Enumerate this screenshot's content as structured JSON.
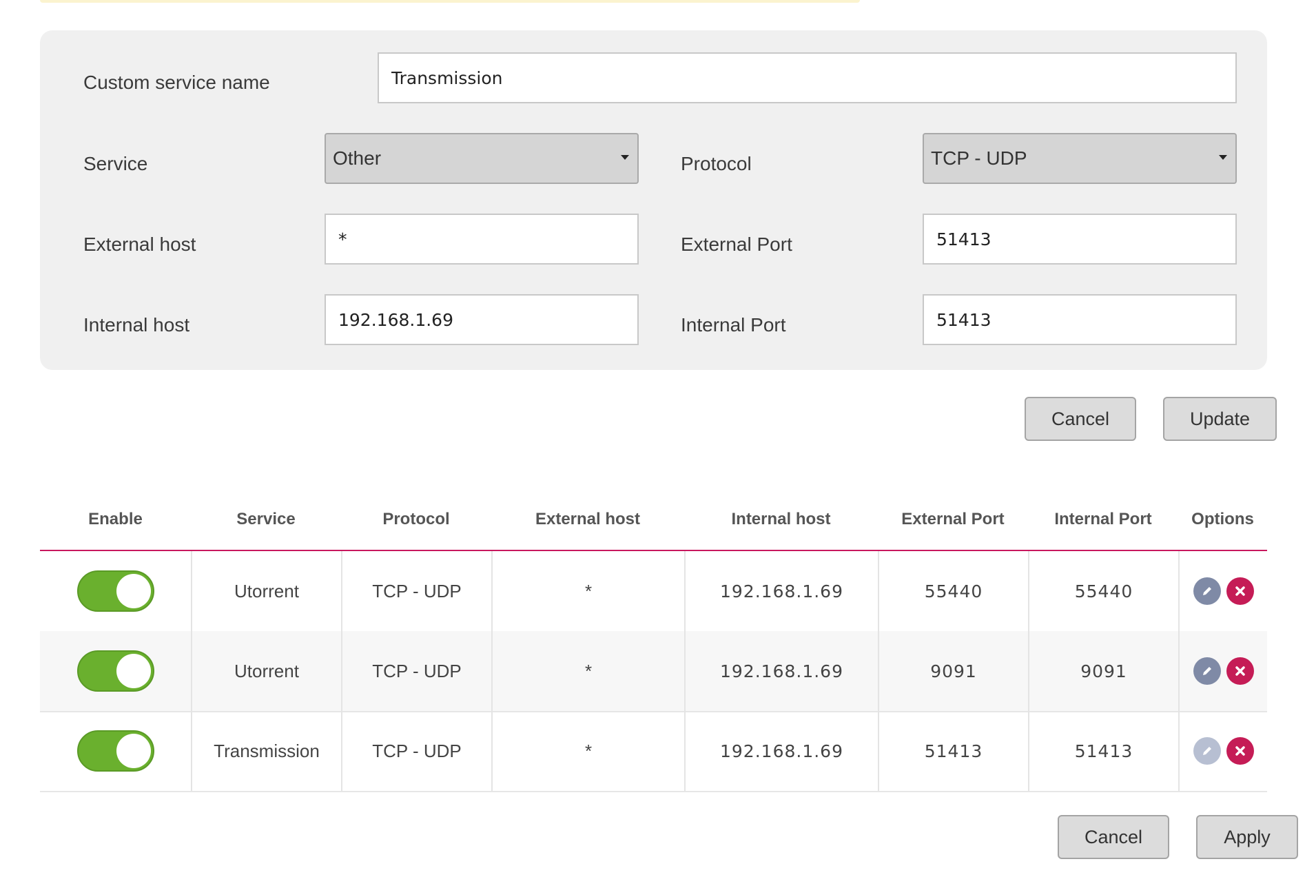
{
  "form": {
    "custom_name_label": "Custom service name",
    "custom_name_value": "Transmission",
    "service_label": "Service",
    "service_value": "Other",
    "protocol_label": "Protocol",
    "protocol_value": "TCP - UDP",
    "external_host_label": "External host",
    "external_host_value": "*",
    "external_port_label": "External Port",
    "external_port_value": "51413",
    "internal_host_label": "Internal host",
    "internal_host_value": "192.168.1.69",
    "internal_port_label": "Internal Port",
    "internal_port_value": "51413",
    "cancel_label": "Cancel",
    "update_label": "Update"
  },
  "table": {
    "headers": [
      "Enable",
      "Service",
      "Protocol",
      "External host",
      "Internal host",
      "External Port",
      "Internal Port",
      "Options"
    ],
    "rows": [
      {
        "enabled": true,
        "service": "Utorrent",
        "protocol": "TCP - UDP",
        "external_host": "*",
        "internal_host": "192.168.1.69",
        "external_port": "55440",
        "internal_port": "55440",
        "edit_disabled": false
      },
      {
        "enabled": true,
        "service": "Utorrent",
        "protocol": "TCP - UDP",
        "external_host": "*",
        "internal_host": "192.168.1.69",
        "external_port": "9091",
        "internal_port": "9091",
        "edit_disabled": false
      },
      {
        "enabled": true,
        "service": "Transmission",
        "protocol": "TCP - UDP",
        "external_host": "*",
        "internal_host": "192.168.1.69",
        "external_port": "51413",
        "internal_port": "51413",
        "edit_disabled": true
      }
    ]
  },
  "footer": {
    "cancel_label": "Cancel",
    "apply_label": "Apply"
  },
  "colors": {
    "accent": "#c8175d",
    "toggle_on": "#6ab02e",
    "edit_icon": "#7f8aa6",
    "delete_icon": "#c51c56"
  },
  "icons": {
    "edit": "pencil-icon",
    "delete": "close-icon",
    "dropdown": "caret-down-icon"
  }
}
